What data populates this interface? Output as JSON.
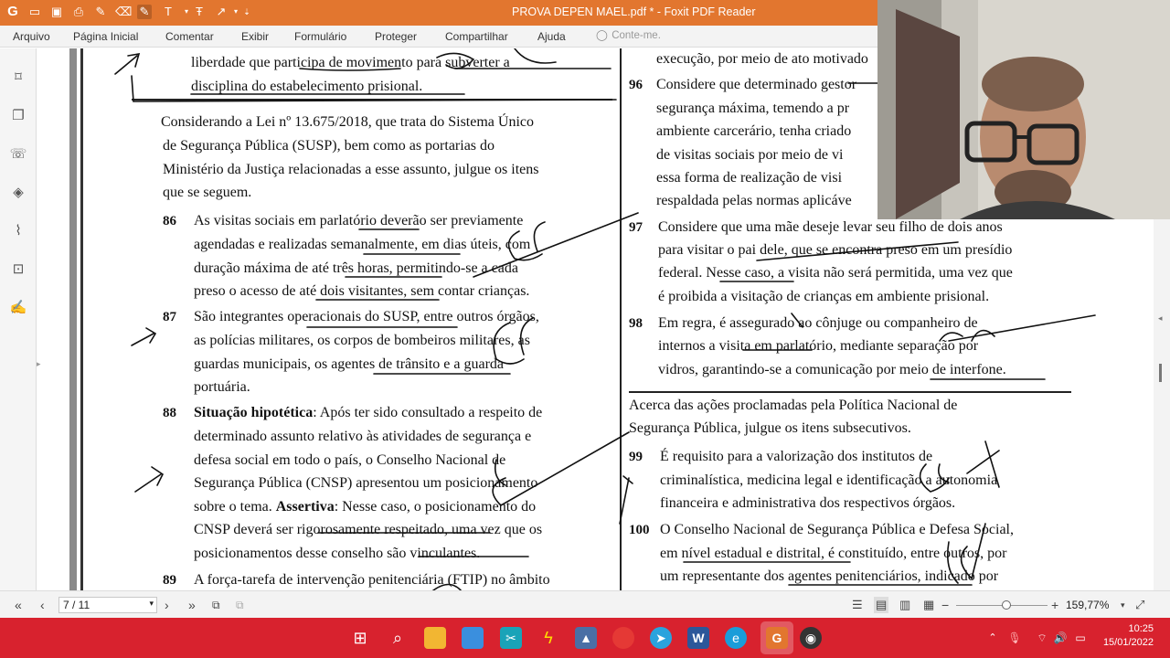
{
  "titlebar": {
    "title": "PROVA DEPEN MAEL.pdf * - Foxit PDF Reader",
    "brand_color": "#e2762f"
  },
  "menu": {
    "items": [
      "Arquivo",
      "Página Inicial",
      "Comentar",
      "Exibir",
      "Formulário",
      "Proteger",
      "Compartilhar",
      "Ajuda"
    ],
    "tell_me_placeholder": "Conte-me."
  },
  "left_column": {
    "top_lines": [
      "liberdade que participa de movimento para subverter a",
      "disciplina do estabelecimento prisional."
    ],
    "intro": [
      "Considerando a Lei nº 13.675/2018, que trata do Sistema Único",
      "de Segurança Pública (SUSP), bem como as portarias do",
      "Ministério da Justiça relacionadas a esse assunto, julgue os itens",
      "que se seguem."
    ],
    "items": [
      {
        "number": "86",
        "lines": [
          "As visitas sociais em parlatório deverão ser previamente",
          "agendadas e realizadas semanalmente, em dias úteis, com",
          "duração máxima de até três horas, permitindo-se a cada",
          "preso o acesso de até dois visitantes, sem contar crianças."
        ]
      },
      {
        "number": "87",
        "lines": [
          "São integrantes operacionais do SUSP, entre outros órgãos,",
          "as polícias militares, os corpos de bombeiros militares, as",
          "guardas municipais, os agentes de trânsito e a guarda",
          "portuária."
        ]
      },
      {
        "number": "88",
        "bold_lead": "Situação hipotética",
        "lines": [
          ": Após ter sido consultado a respeito de",
          "determinado assunto relativo às atividades de segurança e",
          "defesa social em todo o país, o Conselho Nacional de",
          "Segurança Pública (CNSP) apresentou um posicionamento",
          "sobre o tema. ",
          "CNSP deverá ser rigorosamente respeitado, uma vez que os",
          "posicionamentos desse conselho são vinculantes."
        ],
        "bold_mid": "Assertiva",
        "mid_rest": ": Nesse caso, o posicionamento do"
      },
      {
        "number": "89",
        "lines": [
          "A força-tarefa de intervenção penitenciária (FTIP) no âmbito"
        ]
      }
    ]
  },
  "right_column": {
    "top_line": "execução, por meio de ato motivado",
    "items": [
      {
        "number": "96",
        "lines": [
          "Considere que determinado gestor",
          "segurança máxima, temendo a pr",
          "ambiente carcerário, tenha criado",
          "de visitas sociais por meio de vi",
          "essa forma de realização de visi",
          "respaldada pelas normas aplicáve"
        ]
      },
      {
        "number": "97",
        "lines": [
          "Considere que uma mãe deseje levar seu filho de dois anos",
          "para visitar o pai dele, que se encontra preso em um presídio",
          "federal. Nesse caso, a visita não será permitida, uma vez que",
          "é proibida a visitação de crianças em ambiente prisional."
        ]
      },
      {
        "number": "98",
        "lines": [
          "Em regra, é assegurado ao cônjuge ou companheiro de",
          "internos a visita em parlatório, mediante separação por",
          "vidros, garantindo-se a comunicação por meio de interfone."
        ]
      }
    ],
    "intro2": [
      "Acerca das ações proclamadas pela Política Nacional de",
      "Segurança Pública, julgue os itens subsecutivos."
    ],
    "items2": [
      {
        "number": "99",
        "lines": [
          "É requisito para a valorização dos institutos de",
          "criminalística, medicina legal e identificação a autonomia",
          "financeira e administrativa dos respectivos órgãos."
        ]
      },
      {
        "number": "100",
        "lines": [
          "O Conselho Nacional de Segurança Pública e Defesa Social,",
          "em nível estadual e distrital, é constituído, entre outros, por",
          "um representante dos agentes penitenciários, indicado por"
        ]
      }
    ]
  },
  "statusbar": {
    "page_indicator": "7 / 11",
    "zoom": "159,77%",
    "zoom_fraction": 0.55
  },
  "taskbar": {
    "time": "10:25",
    "date": "15/01/2022"
  }
}
